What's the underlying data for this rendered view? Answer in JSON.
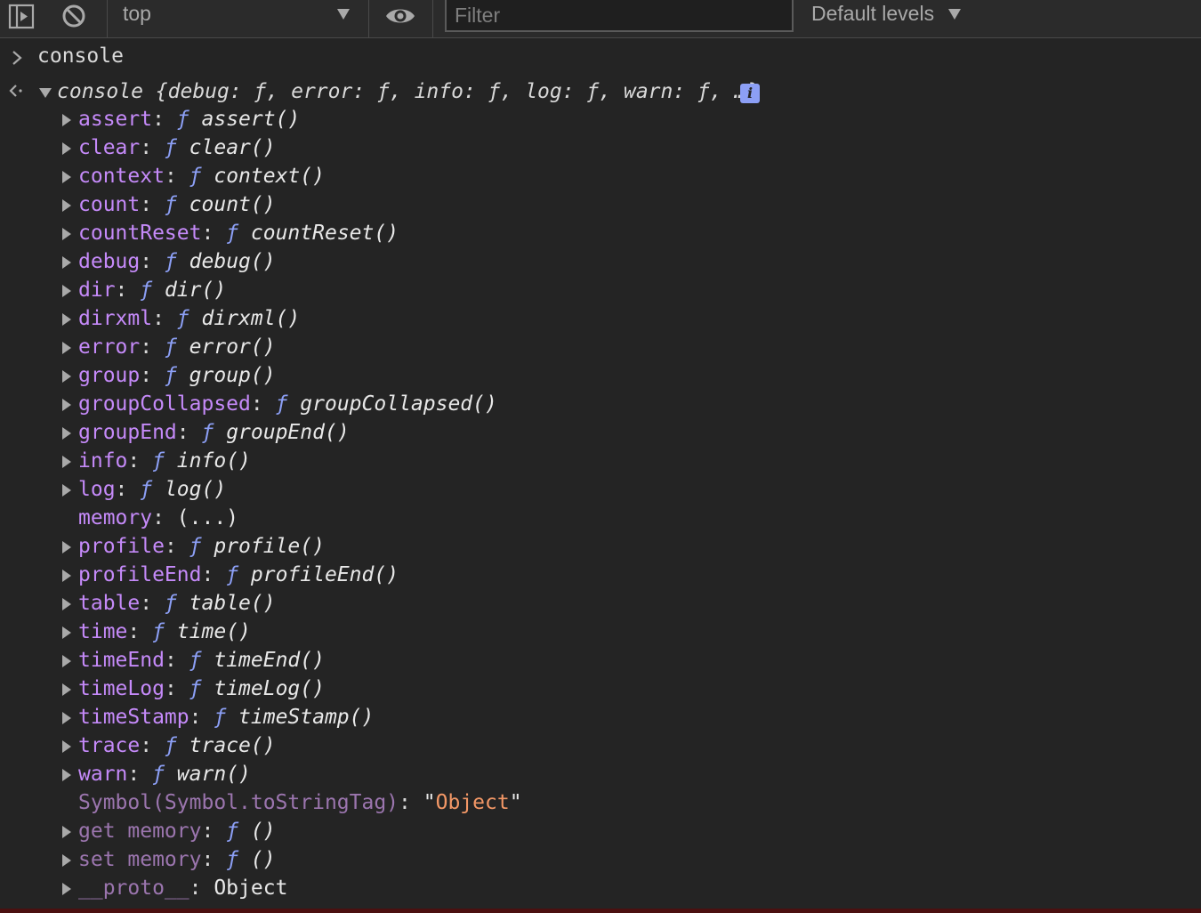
{
  "toolbar": {
    "context_label": "top",
    "filter_placeholder": "Filter",
    "levels_label": "Default levels"
  },
  "console": {
    "input": "console",
    "summary": "console {debug: ƒ, error: ƒ, info: ƒ, log: ƒ, warn: ƒ, …}",
    "info_badge": "i",
    "properties": [
      {
        "key": "assert",
        "sep": ": ",
        "f": "ƒ",
        "value": " assert()",
        "expandable": true
      },
      {
        "key": "clear",
        "sep": ": ",
        "f": "ƒ",
        "value": " clear()",
        "expandable": true
      },
      {
        "key": "context",
        "sep": ": ",
        "f": "ƒ",
        "value": " context()",
        "expandable": true
      },
      {
        "key": "count",
        "sep": ": ",
        "f": "ƒ",
        "value": " count()",
        "expandable": true
      },
      {
        "key": "countReset",
        "sep": ": ",
        "f": "ƒ",
        "value": " countReset()",
        "expandable": true
      },
      {
        "key": "debug",
        "sep": ": ",
        "f": "ƒ",
        "value": " debug()",
        "expandable": true
      },
      {
        "key": "dir",
        "sep": ": ",
        "f": "ƒ",
        "value": " dir()",
        "expandable": true
      },
      {
        "key": "dirxml",
        "sep": ": ",
        "f": "ƒ",
        "value": " dirxml()",
        "expandable": true
      },
      {
        "key": "error",
        "sep": ": ",
        "f": "ƒ",
        "value": " error()",
        "expandable": true
      },
      {
        "key": "group",
        "sep": ": ",
        "f": "ƒ",
        "value": " group()",
        "expandable": true
      },
      {
        "key": "groupCollapsed",
        "sep": ": ",
        "f": "ƒ",
        "value": " groupCollapsed()",
        "expandable": true
      },
      {
        "key": "groupEnd",
        "sep": ": ",
        "f": "ƒ",
        "value": " groupEnd()",
        "expandable": true
      },
      {
        "key": "info",
        "sep": ": ",
        "f": "ƒ",
        "value": " info()",
        "expandable": true
      },
      {
        "key": "log",
        "sep": ": ",
        "f": "ƒ",
        "value": " log()",
        "expandable": true
      },
      {
        "key": "memory",
        "sep": ": ",
        "f": "",
        "value": "(...)",
        "expandable": false
      },
      {
        "key": "profile",
        "sep": ": ",
        "f": "ƒ",
        "value": " profile()",
        "expandable": true
      },
      {
        "key": "profileEnd",
        "sep": ": ",
        "f": "ƒ",
        "value": " profileEnd()",
        "expandable": true
      },
      {
        "key": "table",
        "sep": ": ",
        "f": "ƒ",
        "value": " table()",
        "expandable": true
      },
      {
        "key": "time",
        "sep": ": ",
        "f": "ƒ",
        "value": " time()",
        "expandable": true
      },
      {
        "key": "timeEnd",
        "sep": ": ",
        "f": "ƒ",
        "value": " timeEnd()",
        "expandable": true
      },
      {
        "key": "timeLog",
        "sep": ": ",
        "f": "ƒ",
        "value": " timeLog()",
        "expandable": true
      },
      {
        "key": "timeStamp",
        "sep": ": ",
        "f": "ƒ",
        "value": " timeStamp()",
        "expandable": true
      },
      {
        "key": "trace",
        "sep": ": ",
        "f": "ƒ",
        "value": " trace()",
        "expandable": true
      },
      {
        "key": "warn",
        "sep": ": ",
        "f": "ƒ",
        "value": " warn()",
        "expandable": true
      }
    ],
    "tag_row": {
      "key": "Symbol(Symbol.toStringTag)",
      "sep": ": ",
      "quote_open": "\"",
      "value": "Object",
      "quote_close": "\""
    },
    "accessors": [
      {
        "key": "get memory",
        "sep": ": ",
        "f": "ƒ",
        "value": " ()"
      },
      {
        "key": "set memory",
        "sep": ": ",
        "f": "ƒ",
        "value": " ()"
      }
    ],
    "proto": {
      "key": "__proto__",
      "sep": ": ",
      "value": "Object"
    }
  },
  "colors": {
    "background": "#242424",
    "property_key": "#c58af9",
    "function_symbol": "#8c9ff5",
    "string_value": "#f29766"
  }
}
